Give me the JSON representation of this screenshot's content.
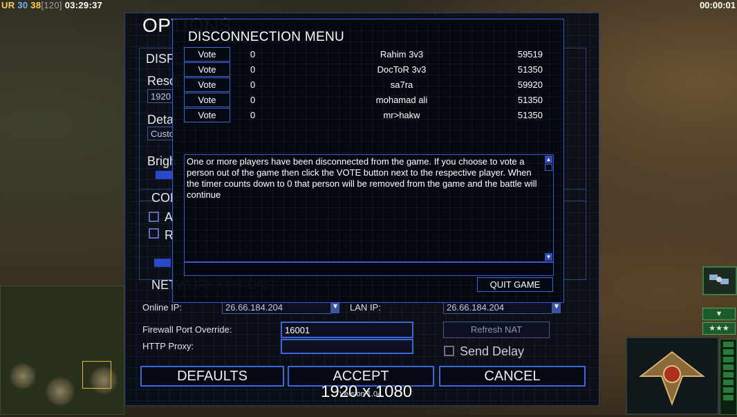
{
  "hud": {
    "faction_tag": "UR",
    "stat_a": "30",
    "stat_b": "38",
    "stat_c": "[120]",
    "clock": "03:29:37",
    "game_timer": "00:00:01",
    "resolution": "1920 x 1080"
  },
  "options": {
    "title": "OPTIONS",
    "display_label": "DISPL",
    "resolution_label": "Resol",
    "resolution_value": "1920",
    "detail_label": "Detai",
    "detail_value": "Custo",
    "brightness_label": "Brigh",
    "controls_label": "CON",
    "check1_label": "A",
    "check2_label": "R",
    "network_label": "NETWORK OPTIONS",
    "online_ip_label": "Online IP:",
    "online_ip_value": "26.66.184.204",
    "lan_ip_label": "LAN IP:",
    "lan_ip_value": "26.66.184.204",
    "firewall_label": "Firewall Port Override:",
    "firewall_value": "16001",
    "http_proxy_label": "HTTP Proxy:",
    "http_proxy_value": "",
    "refresh_nat": "Refresh NAT",
    "send_delay": "Send Delay",
    "defaults": "DEFAULTS",
    "accept": "ACCEPT",
    "cancel": "CANCEL",
    "version": "Version 1.04"
  },
  "disconnect_menu": {
    "title": "DISCONNECTION MENU",
    "vote_label": "Vote",
    "players": [
      {
        "votes": "0",
        "name": "Rahim 3v3",
        "ping": "59519"
      },
      {
        "votes": "0",
        "name": "DocToR 3v3",
        "ping": "51350"
      },
      {
        "votes": "0",
        "name": "sa7ra",
        "ping": "59920"
      },
      {
        "votes": "0",
        "name": "mohamad ali",
        "ping": "51350"
      },
      {
        "votes": "0",
        "name": "mr>hakw",
        "ping": "51350"
      }
    ],
    "message": "One or more players have been disconnected from the game. If you choose to vote a person out of the game then click the VOTE button next to the respective player. When the timer counts down to 0 that person will be removed from the game and the battle will continue",
    "quit": "QUIT GAME"
  },
  "colors": {
    "accent": "#3c67d8",
    "panel": "#050914"
  }
}
